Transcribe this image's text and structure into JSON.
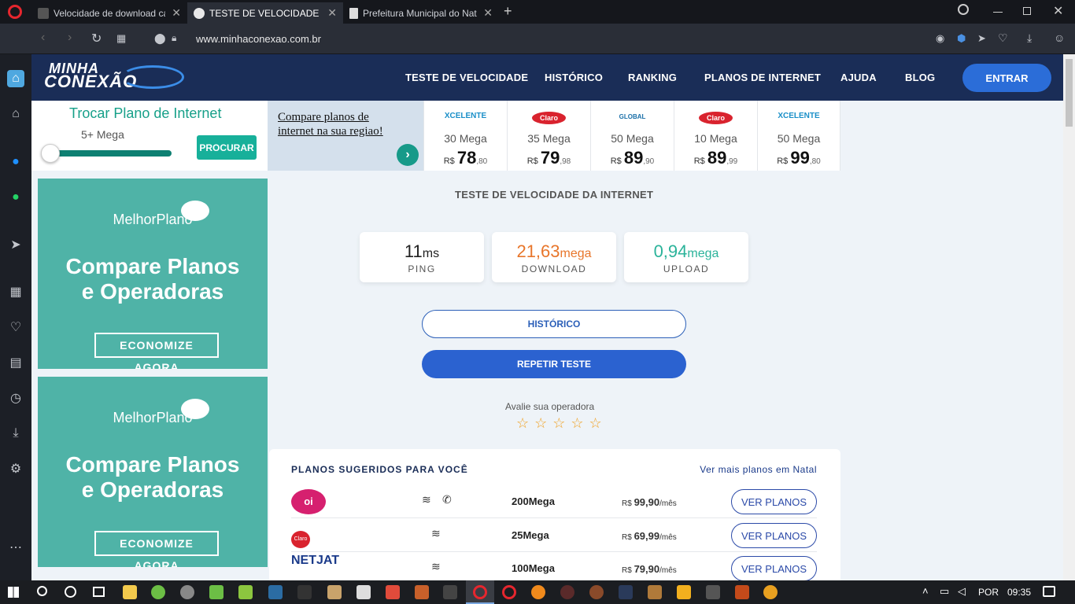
{
  "tabs": [
    {
      "title": "Velocidade de download ca",
      "active": false
    },
    {
      "title": "TESTE DE VELOCIDADE da I",
      "active": true
    },
    {
      "title": "Prefeitura Municipal do Nat",
      "active": false
    }
  ],
  "address": {
    "url": "www.minhaconexao.com.br"
  },
  "site": {
    "logo_top": "MINHA",
    "logo_bottom": "CONEXÃO",
    "nav": [
      "TESTE DE VELOCIDADE",
      "HISTÓRICO",
      "RANKING",
      "PLANOS DE INTERNET",
      "AJUDA",
      "BLOG"
    ],
    "enter": "ENTRAR"
  },
  "trocar": {
    "title": "Trocar Plano de Internet",
    "value": "5+ Mega",
    "button": "PROCURAR"
  },
  "compare": {
    "line1": "Compare planos de",
    "line2": "internet na sua regiao!"
  },
  "plan_cards": [
    {
      "logo": "XCELENTE",
      "mega": "30 Mega",
      "currency": "R$",
      "int": "78",
      "dec": ",80",
      "color": "#f08a1c"
    },
    {
      "logo": "Claro",
      "mega": "35 Mega",
      "currency": "R$",
      "int": "79",
      "dec": ",98",
      "color": "#d9232e"
    },
    {
      "logo": "GLOBAL",
      "mega": "50 Mega",
      "currency": "R$",
      "int": "89",
      "dec": ",90",
      "color": "#1a8fc8"
    },
    {
      "logo": "Claro",
      "mega": "10 Mega",
      "currency": "R$",
      "int": "89",
      "dec": ",99",
      "color": "#d9232e"
    },
    {
      "logo": "XCELENTE",
      "mega": "50 Mega",
      "currency": "R$",
      "int": "99",
      "dec": ",80",
      "color": "#f08a1c"
    }
  ],
  "ads": [
    {
      "brand": "MelhorPlano",
      "headline1": "Compare Planos",
      "headline2": "e Operadoras",
      "cta": "ECONOMIZE AGORA"
    },
    {
      "brand": "MelhorPlano",
      "headline1": "Compare Planos",
      "headline2": "e Operadoras",
      "cta": "ECONOMIZE AGORA"
    }
  ],
  "speed": {
    "title": "TESTE DE VELOCIDADE DA INTERNET",
    "ping": {
      "value": "11",
      "unit": "ms",
      "label": "PING"
    },
    "download": {
      "value": "21,63",
      "unit": "mega",
      "label": "DOWNLOAD"
    },
    "upload": {
      "value": "0,94",
      "unit": "mega",
      "label": "UPLOAD"
    },
    "history_btn": "HISTÓRICO",
    "repeat_btn": "REPETIR TESTE",
    "rate_label": "Avalie sua operadora",
    "stars": "☆ ☆ ☆ ☆ ☆"
  },
  "suggested": {
    "title": "PLANOS SUGERIDOS PARA VOCÊ",
    "more": "Ver mais planos em Natal",
    "rows": [
      {
        "logo": "oi",
        "speed": "200Mega",
        "currency": "R$",
        "price": "99,90",
        "per": "/mês",
        "button": "VER PLANOS"
      },
      {
        "logo": "Claro",
        "speed": "25Mega",
        "currency": "R$",
        "price": "69,99",
        "per": "/mês",
        "button": "VER PLANOS"
      },
      {
        "logo": "NETJAT",
        "speed": "100Mega",
        "currency": "R$",
        "price": "79,90",
        "per": "/mês",
        "button": "VER PLANOS"
      }
    ]
  },
  "taskbar": {
    "lang": "POR",
    "time": "09:35"
  },
  "colors": {
    "header": "#1a2d57",
    "accent": "#2b62d0",
    "teal": "#4fb3a7",
    "download": "#e8762b",
    "upload": "#2bb39a"
  }
}
